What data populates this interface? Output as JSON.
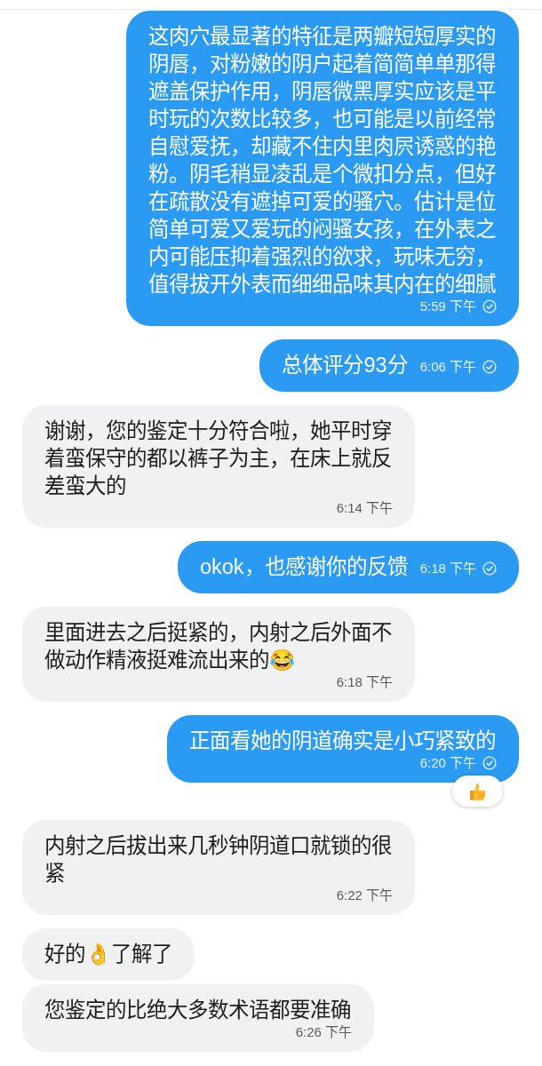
{
  "messages": [
    {
      "kind": "outgoing",
      "text": "这肉穴最显著的特征是两瓣短短厚实的阴唇，对粉嫩的阴户起着简简单单那得遮盖保护作用，阴唇微黑厚实应该是平时玩的次数比较多，也可能是以前经常自慰爱抚，却藏不住内里肉屄诱惑的艳粉。阴毛稍显凌乱是个微扣分点，但好在疏散没有遮掉可爱的骚穴。估计是位简单可爱又爱玩的闷骚女孩，在外表之内可能压抑着强烈的欲求，玩味无穷，值得拔开外表而细细品味其内在的细腻",
      "time": "5:59 下午",
      "read": true
    },
    {
      "kind": "outgoing",
      "text": "总体评分93分",
      "time": "6:06 下午",
      "read": true
    },
    {
      "kind": "incoming",
      "text": "谢谢，您的鉴定十分符合啦，她平时穿着蛮保守的都以裤子为主，在床上就反差蛮大的",
      "time": "6:14 下午"
    },
    {
      "kind": "outgoing",
      "text": "okok，也感谢你的反馈",
      "time": "6:18 下午",
      "read": true
    },
    {
      "kind": "incoming",
      "text": "里面进去之后挺紧的，内射之后外面不做动作精液挺难流出来的😂",
      "time": "6:18 下午"
    },
    {
      "kind": "outgoing",
      "text": "正面看她的阴道确实是小巧紧致的",
      "time": "6:20 下午",
      "read": true,
      "reaction": true
    },
    {
      "kind": "incoming",
      "text": "内射之后拔出来几秒钟阴道口就锁的很紧",
      "time": "6:22 下午"
    },
    {
      "kind": "incoming",
      "text": "好的👌了解了"
    },
    {
      "kind": "incoming",
      "text": "您鉴定的比绝大多数术语都要准确",
      "time": "6:26 下午"
    }
  ]
}
